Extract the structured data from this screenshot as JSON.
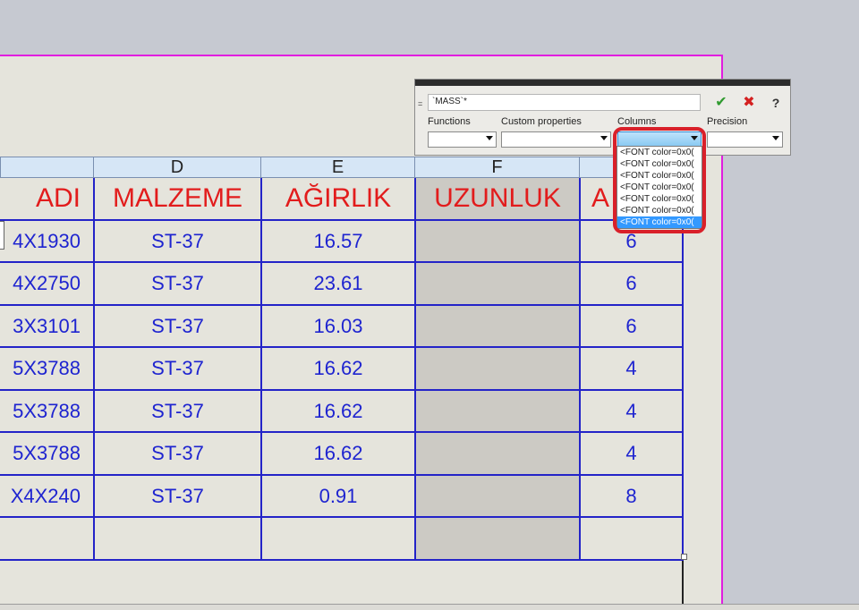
{
  "formula_bar": {
    "equals": "=",
    "expression": "`MASS`*",
    "ok_icon": "✔",
    "cancel_icon": "✖",
    "help_icon": "?",
    "labels": {
      "functions": "Functions",
      "custom_properties": "Custom properties",
      "columns": "Columns",
      "precision": "Precision"
    }
  },
  "dropdown_items": [
    "<FONT color=0x0(",
    "<FONT color=0x0(",
    "<FONT color=0x0(",
    "<FONT color=0x0(",
    "<FONT color=0x0(",
    "<FONT color=0x0(",
    "<FONT color=0x0("
  ],
  "column_letters": [
    "D",
    "E",
    "F",
    ""
  ],
  "table": {
    "headers": [
      "ADI",
      "MALZEME",
      "AĞIRLIK",
      "UZUNLUK",
      "A"
    ],
    "rows": [
      [
        "4X1930",
        "ST-37",
        "16.57",
        "",
        "6"
      ],
      [
        "4X2750",
        "ST-37",
        "23.61",
        "",
        "6"
      ],
      [
        "3X3101",
        "ST-37",
        "16.03",
        "",
        "6"
      ],
      [
        "5X3788",
        "ST-37",
        "16.62",
        "",
        "4"
      ],
      [
        "5X3788",
        "ST-37",
        "16.62",
        "",
        "4"
      ],
      [
        "5X3788",
        "ST-37",
        "16.62",
        "",
        "4"
      ],
      [
        "X4X240",
        "ST-37",
        "0.91",
        "",
        "8"
      ],
      [
        "",
        "",
        "",
        "",
        ""
      ]
    ]
  }
}
